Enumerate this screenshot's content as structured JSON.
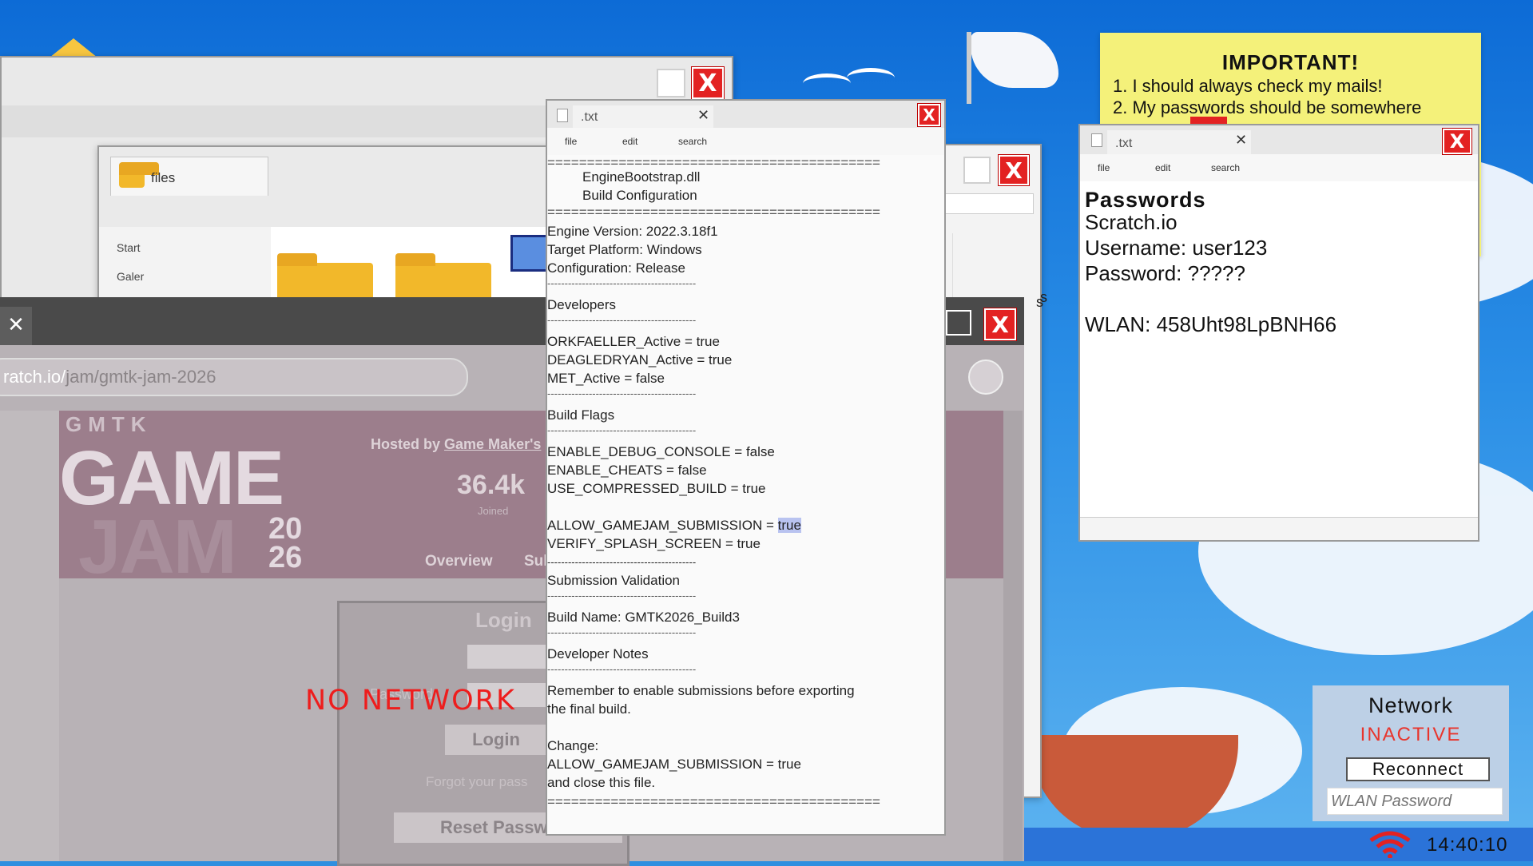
{
  "file_explorer": {
    "tab_label": "files",
    "sidebar_items": [
      "Start",
      "Galer"
    ]
  },
  "browser": {
    "address_host": "ratch.io/",
    "address_path": "jam/gmtk-jam-2026",
    "gmtk_letters": [
      "G",
      "M",
      "T",
      "K"
    ],
    "game_word": "GAME",
    "jam_word": "JAM",
    "year_top": "20",
    "year_bottom": "26",
    "hosted_by": "Hosted by",
    "hosted_link": "Game Maker's",
    "joined_count": "36.4k",
    "joined_label": "Joined",
    "nav_overview": "Overview",
    "nav_sub": "Sul",
    "login_title": "Login",
    "password_label": "Password",
    "login_button": "Login",
    "forgot_text": "Forgot your pass",
    "reset_button": "Reset Password",
    "no_network": "NO NETWORK"
  },
  "config_file": {
    "tab": ".txt",
    "menu": [
      "file",
      "edit",
      "search"
    ],
    "dash_long": "==========================================",
    "dash_short": "-------------------------------------------",
    "title1": "EngineBootstrap.dll",
    "title2": "Build Configuration",
    "engine_version": "Engine Version: 2022.3.18f1",
    "target_platform": "Target Platform: Windows",
    "configuration": "Configuration: Release",
    "developers_header": "Developers",
    "dev1": "ORKFAELLER_Active = true",
    "dev2": "DEAGLEDRYAN_Active = true",
    "dev3": "MET_Active = false",
    "build_flags_header": "Build Flags",
    "flag1": "ENABLE_DEBUG_CONSOLE = false",
    "flag2": "ENABLE_CHEATS = false",
    "flag3": "USE_COMPRESSED_BUILD = true",
    "flag4_prefix": "ALLOW_GAMEJAM_SUBMISSION = ",
    "flag4_value": "true",
    "flag5": "VERIFY_SPLASH_SCREEN = true",
    "validation_header": "Submission Validation",
    "build_name": "Build Name: GMTK2026_Build3",
    "notes_header": "Developer Notes",
    "note1": "Remember to enable submissions before exporting",
    "note2": "the final build.",
    "change_label": "Change:",
    "change1": "ALLOW_GAMEJAM_SUBMISSION = true",
    "change2": "and close this file."
  },
  "passwords_file": {
    "tab": ".txt",
    "menu": [
      "file",
      "edit",
      "search"
    ],
    "title": "Passwords",
    "site": "Scratch.io",
    "username": "Username: user123",
    "password": "Password: ?????",
    "wlan": "WLAN: 458Uht98LpBNH66"
  },
  "sticky_note": {
    "title": "IMPORTANT!",
    "line1": "1. I should always check my mails!",
    "line2": "2. My passwords should be somewhere"
  },
  "background_window_text": "s",
  "network_widget": {
    "title": "Network",
    "status": "INACTIVE",
    "reconnect_button": "Reconnect",
    "wlan_placeholder": "WLAN Password"
  },
  "taskbar": {
    "clock": "14:40:10"
  },
  "colors": {
    "accent_red": "#e32222",
    "inactive_red": "#e8352d",
    "sticky_yellow": "#f4f17a"
  }
}
